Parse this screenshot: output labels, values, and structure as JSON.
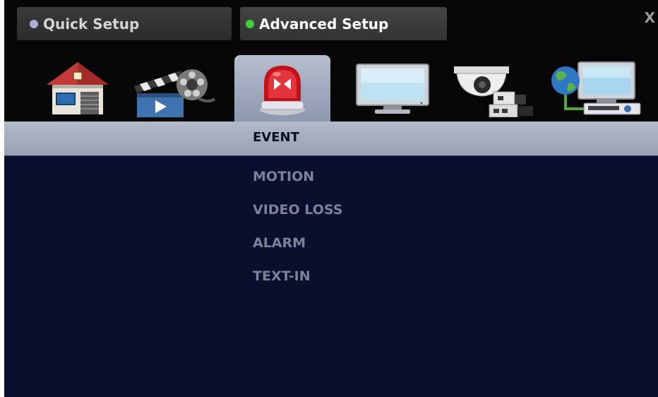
{
  "tabs": {
    "quick_setup": {
      "label": "Quick Setup",
      "dot_color": "#a7aed8"
    },
    "advanced_setup": {
      "label": "Advanced Setup",
      "dot_color": "#3fd13c",
      "selected": true
    }
  },
  "close_label": "X",
  "icon_tabs": [
    {
      "icon": "house-icon",
      "selected": false
    },
    {
      "icon": "film-recording-icon",
      "selected": false
    },
    {
      "icon": "alarm-siren-icon",
      "selected": true
    },
    {
      "icon": "monitor-icon",
      "selected": false
    },
    {
      "icon": "camera-icon",
      "selected": false
    },
    {
      "icon": "network-icon",
      "selected": false
    }
  ],
  "section_title": "EVENT",
  "menu_items": [
    "MOTION",
    "VIDEO LOSS",
    "ALARM",
    "TEXT-IN"
  ],
  "colors": {
    "content_background": "#0a0f2e",
    "menu_text": "#7d8296",
    "title_bar": "#a7aec0"
  }
}
